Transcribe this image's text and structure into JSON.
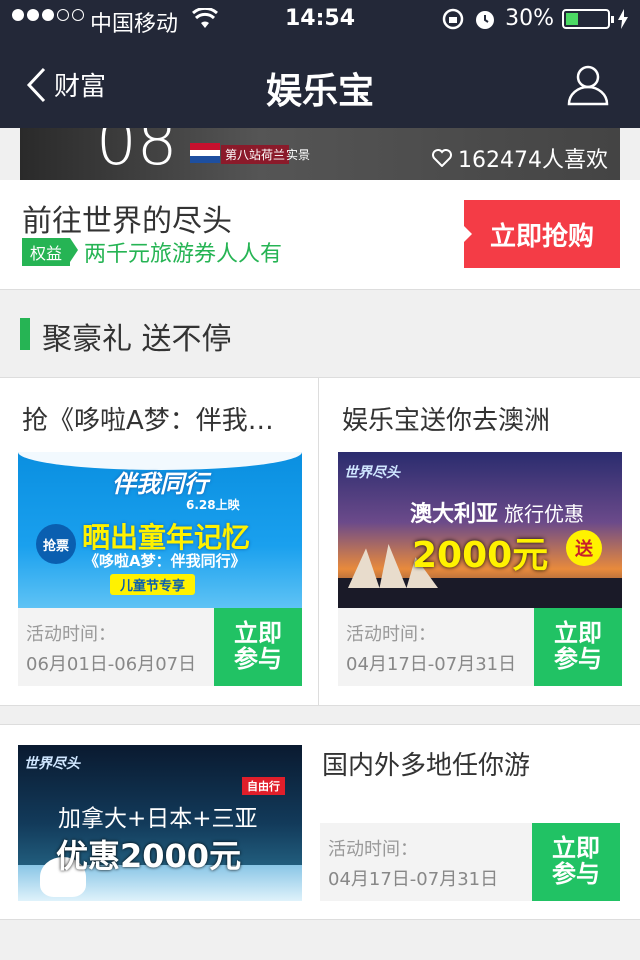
{
  "status_bar": {
    "carrier": "中国移动",
    "time": "14:54",
    "battery_percent": "30%",
    "battery_level": 0.3
  },
  "nav": {
    "back_label": "财富",
    "title": "娱乐宝"
  },
  "banner": {
    "number": "08",
    "station": "第八站荷兰",
    "real": "实景",
    "likes": "162474人喜欢"
  },
  "promo": {
    "title": "前往世界的尽头",
    "tag": "权益",
    "tag_text": "两千元旅游券人人有",
    "button": "立即抢购"
  },
  "section": {
    "title": "聚豪礼 送不停"
  },
  "cards": [
    {
      "title": "抢《哆啦A梦：伴我…",
      "image": {
        "line1": "伴我同行",
        "line2": "6.28上映",
        "badge": "抢票",
        "line3": "晒出童年记忆",
        "line4": "《哆啦A梦：伴我同行》",
        "line5": "儿童节专享"
      },
      "time_label": "活动时间：",
      "dates": "06月01日-06月07日",
      "button": "立即参与"
    },
    {
      "title": "娱乐宝送你去澳洲",
      "image": {
        "line1": "澳大利亚",
        "line1b": "旅行优惠",
        "line2": "2000元",
        "badge": "送"
      },
      "time_label": "活动时间：",
      "dates": "04月17日-07月31日",
      "button": "立即参与"
    }
  ],
  "row3": {
    "title": "国内外多地任你游",
    "image": {
      "badge": "自由行",
      "line1": "加拿大+日本+三亚",
      "line2": "优惠2000元"
    },
    "time_label": "活动时间：",
    "dates": "04月17日-07月31日",
    "button": "立即参与"
  },
  "colors": {
    "nav_bg": "#232838",
    "green": "#26b454",
    "join_green": "#21c264",
    "red": "#f43c46"
  }
}
